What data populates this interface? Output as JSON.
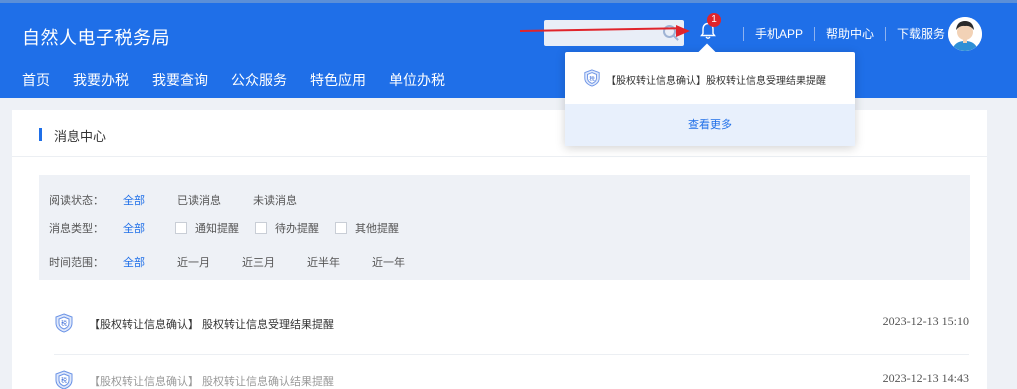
{
  "header": {
    "logo": "自然人电子税务局",
    "bell_badge": "1",
    "links": [
      "手机APP",
      "帮助中心",
      "下载服务"
    ]
  },
  "nav": [
    "首页",
    "我要办税",
    "我要查询",
    "公众服务",
    "特色应用",
    "单位办税"
  ],
  "page": {
    "title": "消息中心"
  },
  "filters": {
    "read_status": {
      "label": "阅读状态：",
      "options": [
        "全部",
        "已读消息",
        "未读消息"
      ]
    },
    "msg_type": {
      "label": "消息类型：",
      "all": "全部",
      "checks": [
        "通知提醒",
        "待办提醒",
        "其他提醒"
      ]
    },
    "time_range": {
      "label": "时间范围：",
      "options": [
        "全部",
        "近一月",
        "近三月",
        "近半年",
        "近一年"
      ]
    }
  },
  "messages": [
    {
      "text": "【股权转让信息确认】 股权转让信息受理结果提醒",
      "time": "2023-12-13 15:10"
    },
    {
      "text": "【股权转让信息确认】 股权转让信息确认结果提醒",
      "time": "2023-12-13 14:43"
    }
  ],
  "popup": {
    "item": "【股权转让信息确认】股权转让信息受理结果提醒",
    "more": "查看更多"
  },
  "colors": {
    "brand": "#1f6fe8",
    "alert": "#e0242b"
  }
}
